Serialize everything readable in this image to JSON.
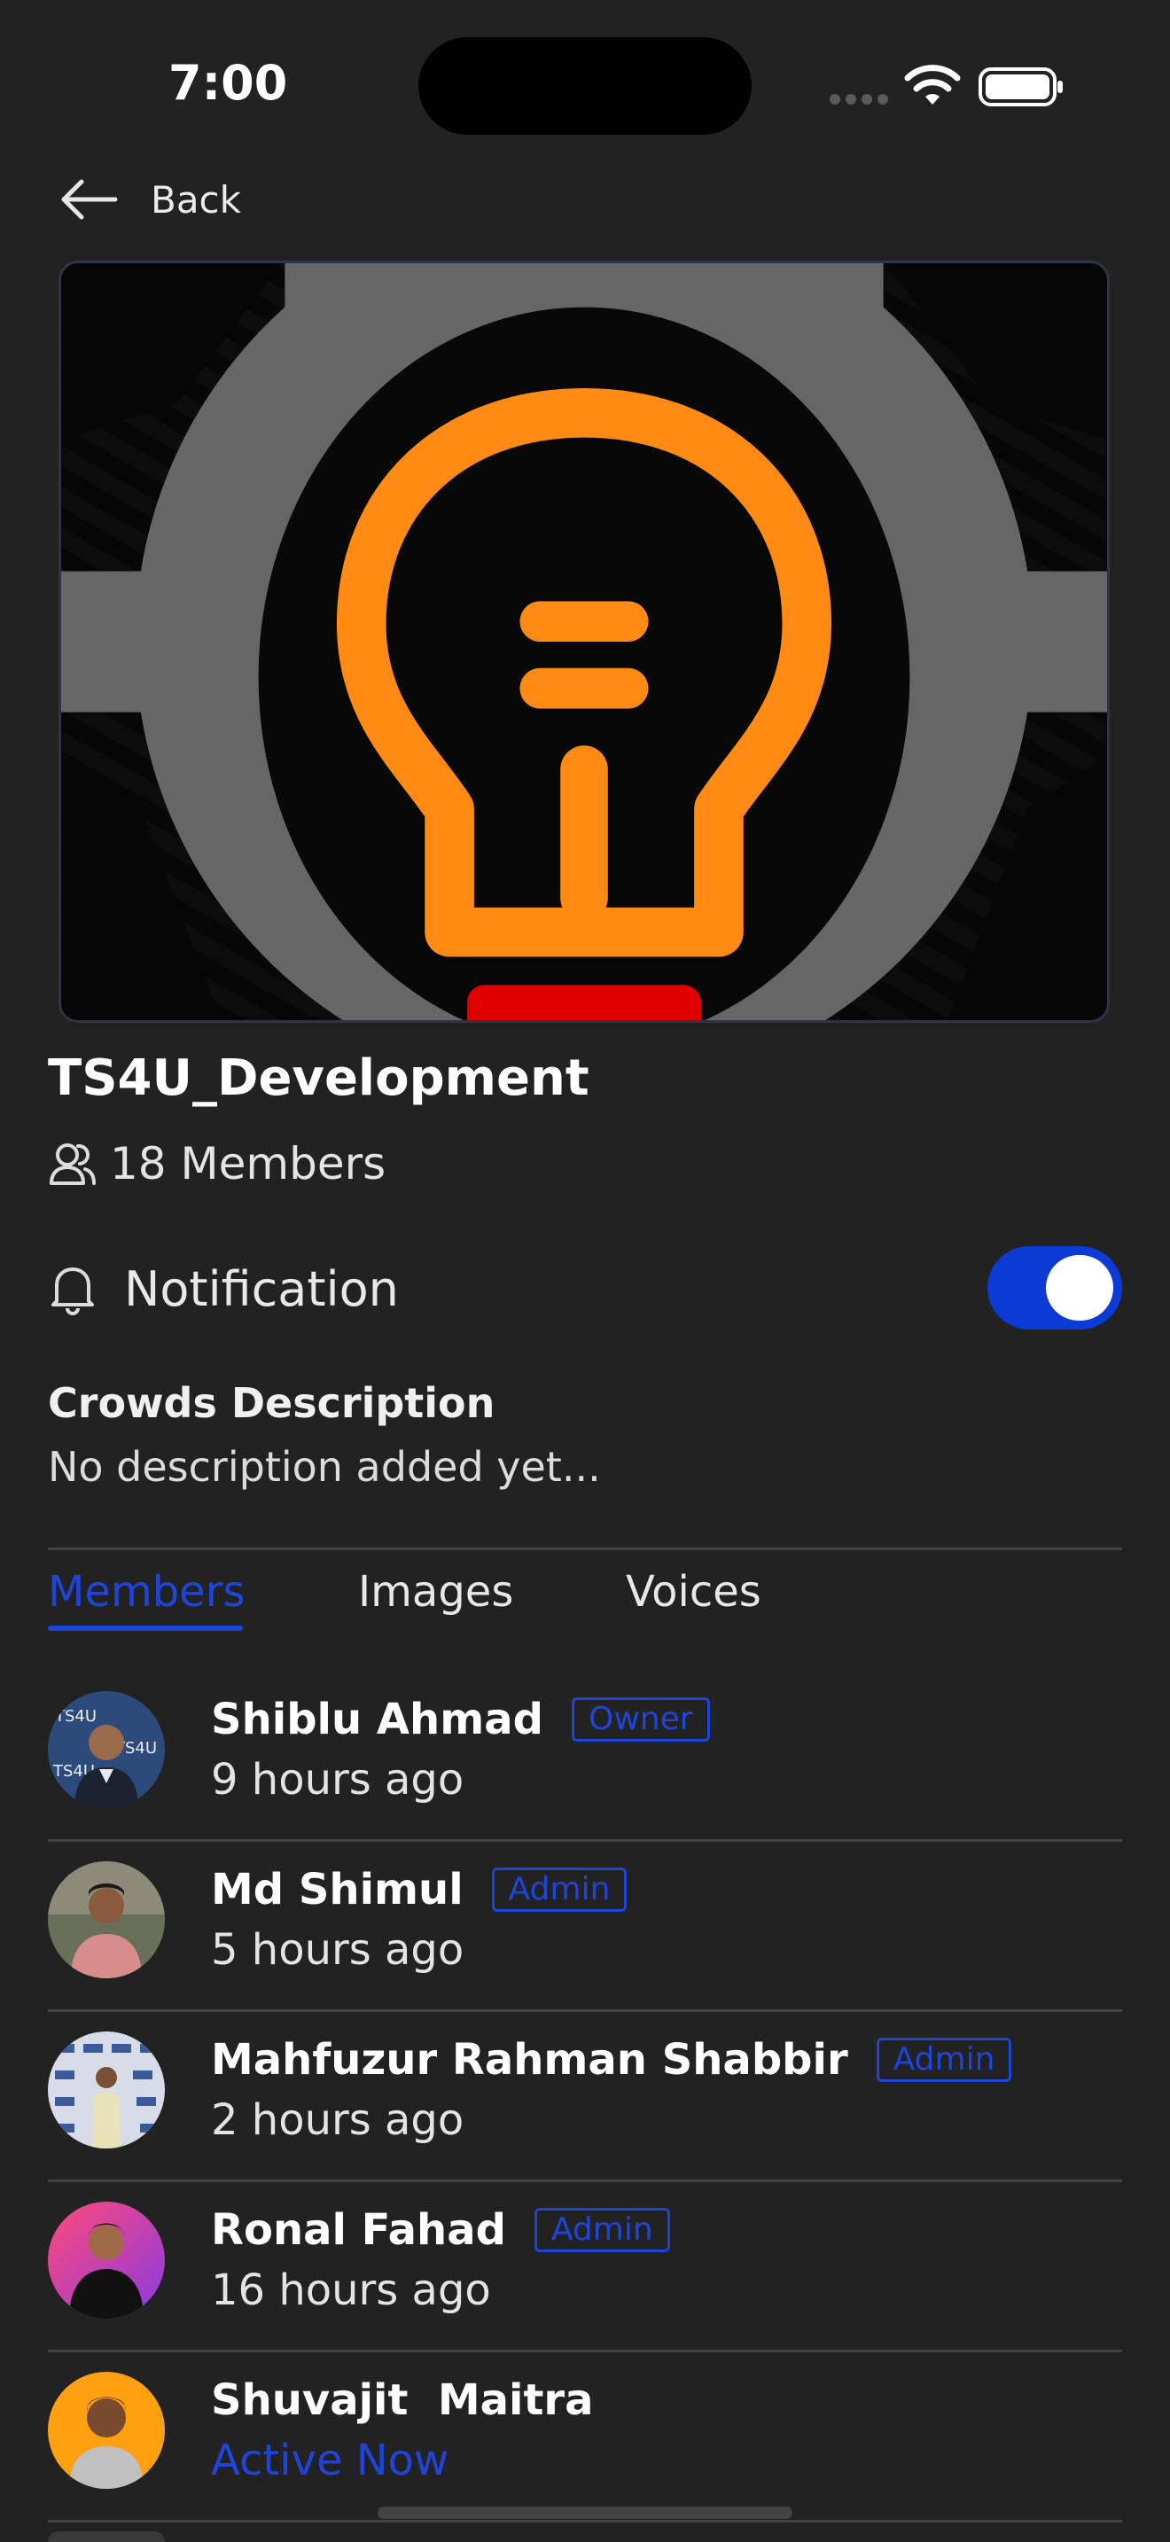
{
  "status_bar": {
    "time": "7:00"
  },
  "nav": {
    "back_label": "Back"
  },
  "group": {
    "name": "TS4U_Development",
    "members_count": "18 Members",
    "notification_label": "Notification",
    "notification_on": true,
    "description_title": "Crowds Description",
    "description_text": "No description added yet..."
  },
  "tabs": [
    {
      "label": "Members",
      "active": true
    },
    {
      "label": "Images",
      "active": false
    },
    {
      "label": "Voices",
      "active": false
    }
  ],
  "members": [
    {
      "name": "Shiblu Ahmad",
      "role": "Owner",
      "status": "9 hours ago"
    },
    {
      "name": "Md Shimul",
      "role": "Admin",
      "status": "5 hours ago"
    },
    {
      "name": "Mahfuzur Rahman Shabbir",
      "role": "Admin",
      "status": "2 hours ago"
    },
    {
      "name": "Ronal Fahad",
      "role": "Admin",
      "status": "16 hours ago"
    },
    {
      "name": "Shuvajit  Maitra",
      "role": "",
      "status": "Active Now"
    }
  ],
  "colors": {
    "background": "#222223",
    "accent": "#1f45d8",
    "toggle_on": "#0b3ad4",
    "logo_orange": "#ff8a14",
    "logo_gear": "#666666"
  },
  "icons": {
    "back": "back-arrow-icon",
    "members": "members-icon",
    "notification": "bell-icon",
    "wifi": "wifi-icon",
    "battery": "battery-icon"
  }
}
